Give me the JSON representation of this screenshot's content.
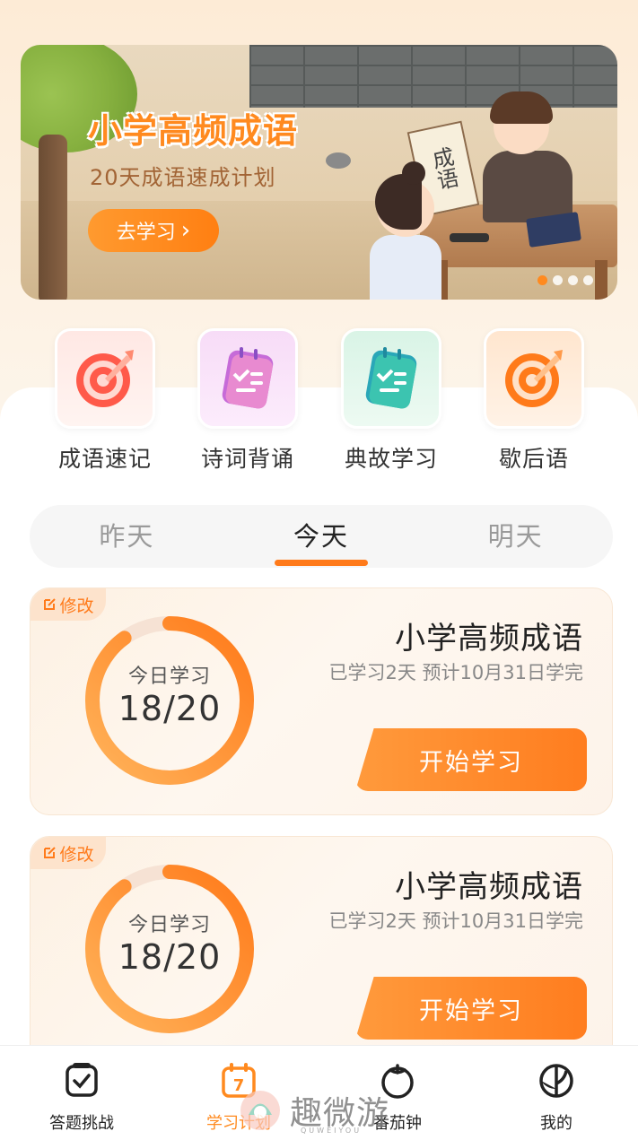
{
  "banner": {
    "title": "小学高频成语",
    "subtitle": "20天成语速成计划",
    "button_label": "去学习",
    "button_arrow": "›",
    "scroll_text": "成语",
    "page_dots": 4,
    "active_dot": 0,
    "accent_color": "#ff8a1f"
  },
  "categories": [
    {
      "label": "成语速记",
      "icon": "target-icon"
    },
    {
      "label": "诗词背诵",
      "icon": "notebook-icon"
    },
    {
      "label": "典故学习",
      "icon": "notebook-icon"
    },
    {
      "label": "歇后语",
      "icon": "target-icon"
    }
  ],
  "tabs": [
    {
      "label": "昨天",
      "active": false
    },
    {
      "label": "今天",
      "active": true
    },
    {
      "label": "明天",
      "active": false
    }
  ],
  "plans": [
    {
      "edit_label": "修改",
      "ring_label": "今日学习",
      "ring_value": "18/20",
      "progress": 0.9,
      "title": "小学高频成语",
      "subtitle": "已学习2天 预计10月31日学完",
      "button_label": "开始学习"
    },
    {
      "edit_label": "修改",
      "ring_label": "今日学习",
      "ring_value": "18/20",
      "progress": 0.9,
      "title": "小学高频成语",
      "subtitle": "已学习2天 预计10月31日学完",
      "button_label": "开始学习"
    }
  ],
  "bottom_nav": [
    {
      "label": "答题挑战",
      "icon": "quiz-icon",
      "active": false
    },
    {
      "label": "学习计划",
      "icon": "calendar-icon",
      "active": true,
      "badge": "7"
    },
    {
      "label": "番茄钟",
      "icon": "tomato-icon",
      "active": false
    },
    {
      "label": "我的",
      "icon": "profile-icon",
      "active": false
    }
  ],
  "watermark": {
    "text": "趣微游",
    "sub": "QUWEIYOU"
  }
}
